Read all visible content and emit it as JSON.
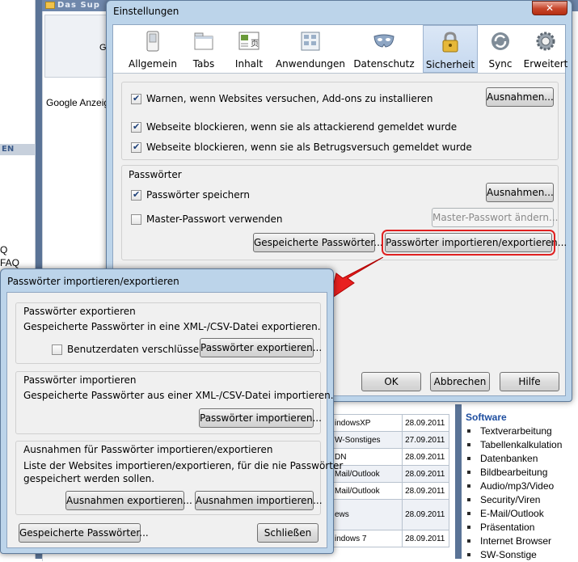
{
  "background": {
    "header_title": "Das Sup",
    "left_bar": "EN",
    "left_q": "Q",
    "left_faq": "FAQ",
    "input_fragment": "G",
    "google": "Google Anzeig",
    "software_title": "Software",
    "software_items": [
      "Textverarbeitung",
      "Tabellenkalkulation",
      "Datenbanken",
      "Bildbearbeitung",
      "Audio/mp3/Video",
      "Security/Viren",
      "E-Mail/Outlook",
      "Präsentation",
      "Internet Browser",
      "SW-Sonstige"
    ],
    "table_rows": [
      {
        "topic": "indowsXP",
        "date": "28.09.2011"
      },
      {
        "topic": "W-Sonstiges",
        "date": "27.09.2011"
      },
      {
        "topic": "DN",
        "date": "28.09.2011"
      },
      {
        "topic": "Mail/Outlook",
        "date": "28.09.2011"
      },
      {
        "topic": "Mail/Outlook",
        "date": "28.09.2011"
      },
      {
        "topic": "ews",
        "date": "28.09.2011"
      },
      {
        "topic": "indows 7",
        "date": "28.09.2011"
      }
    ]
  },
  "settings": {
    "title": "Einstellungen",
    "close_label": "✕",
    "tabs": [
      {
        "label": "Allgemein",
        "icon": "switch-icon"
      },
      {
        "label": "Tabs",
        "icon": "tabs-icon"
      },
      {
        "label": "Inhalt",
        "icon": "content-icon"
      },
      {
        "label": "Anwendungen",
        "icon": "applications-icon"
      },
      {
        "label": "Datenschutz",
        "icon": "privacy-mask-icon"
      },
      {
        "label": "Sicherheit",
        "icon": "padlock-icon"
      },
      {
        "label": "Sync",
        "icon": "sync-icon"
      },
      {
        "label": "Erweitert",
        "icon": "gear-icon"
      }
    ],
    "selected_tab": "Sicherheit",
    "warn_addons": "Warnen, wenn Websites versuchen, Add-ons zu installieren",
    "exceptions_btn": "Ausnahmen...",
    "block_attack": "Webseite blockieren, wenn sie als attackierend gemeldet wurde",
    "block_fraud": "Webseite blockieren, wenn sie als Betrugsversuch gemeldet wurde",
    "passwords_title": "Passwörter",
    "save_passwords": "Passwörter speichern",
    "exceptions_btn2": "Ausnahmen...",
    "master_password": "Master-Passwort verwenden",
    "change_master": "Master-Passwort ändern...",
    "saved_passwords": "Gespeicherte Passwörter...",
    "import_export": "Passwörter importieren/exportieren...",
    "ok": "OK",
    "cancel": "Abbrechen",
    "help": "Hilfe"
  },
  "dialog": {
    "title": "Passwörter importieren/exportieren",
    "export_title": "Passwörter exportieren",
    "export_desc": "Gespeicherte Passwörter in eine XML-/CSV-Datei exportieren.",
    "encrypt_label": "Benutzerdaten verschlüsseln",
    "export_btn": "Passwörter exportieren...",
    "import_title": "Passwörter importieren",
    "import_desc": "Gespeicherte Passwörter aus einer XML-/CSV-Datei importieren.",
    "import_btn": "Passwörter importieren...",
    "exc_title": "Ausnahmen für Passwörter importieren/exportieren",
    "exc_desc_1": "Liste der Websites importieren/exportieren, für die nie Passwörter",
    "exc_desc_2": "gespeichert werden sollen.",
    "exc_export_btn": "Ausnahmen exportieren...",
    "exc_import_btn": "Ausnahmen importieren...",
    "saved_btn": "Gespeicherte Passwörter...",
    "close_btn": "Schließen"
  }
}
